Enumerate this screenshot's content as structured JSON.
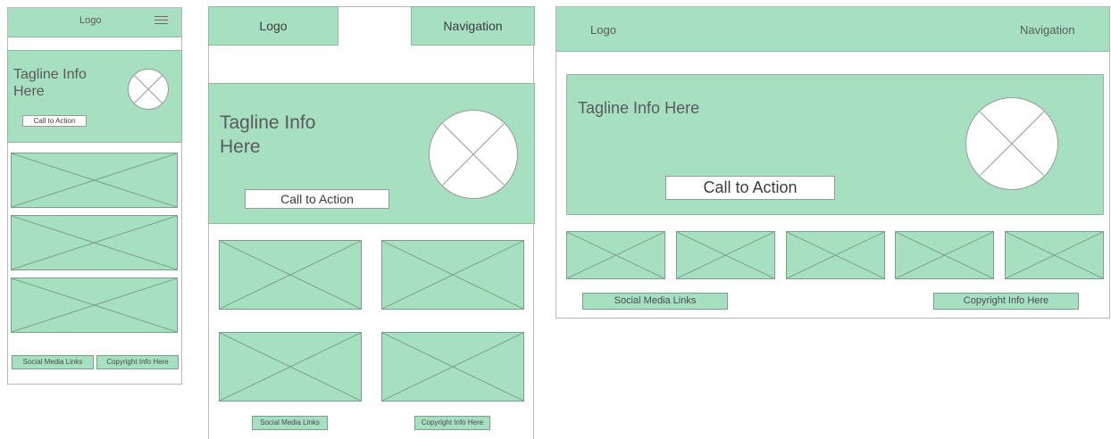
{
  "mobile": {
    "logo": "Logo",
    "tagline": "Tagline Info Here",
    "cta": "Call to Action",
    "social": "Social Media Links",
    "copyright": "Copyright Info Here"
  },
  "tablet": {
    "logo": "Logo",
    "nav": "Navigation",
    "tagline": "Tagline Info Here",
    "cta": "Call to Action",
    "social": "Social Media Links",
    "copyright": "Copyright Info Here"
  },
  "desktop": {
    "logo": "Logo",
    "nav": "Navigation",
    "tagline": "Tagline Info Here",
    "cta": "Call to Action",
    "social": "Social Media Links",
    "copyright": "Copyright Info Here"
  },
  "colors": {
    "block_fill": "#a6e0c0",
    "frame_border": "#b8b8b8",
    "text": "#5a5a5a"
  },
  "icons": {
    "menu": "hamburger-icon",
    "image_placeholder": "image-placeholder-icon"
  }
}
